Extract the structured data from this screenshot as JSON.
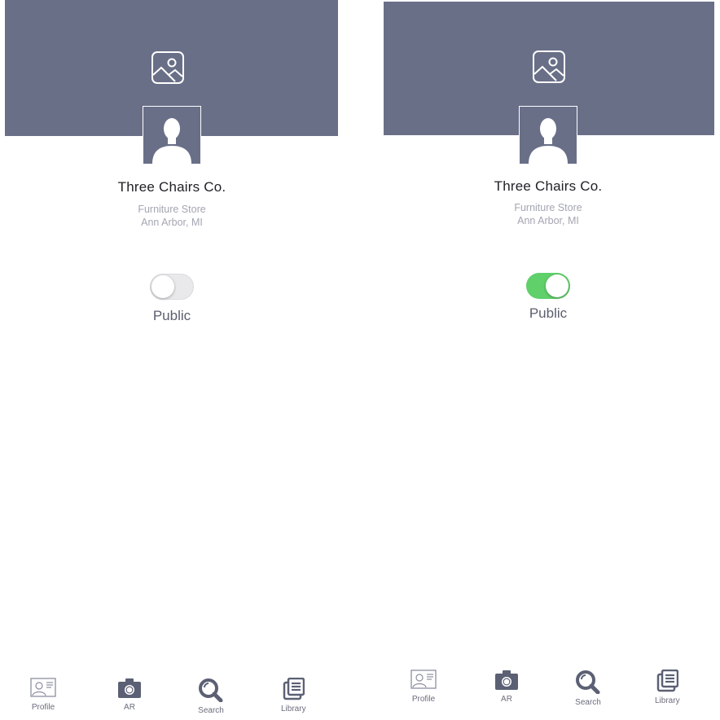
{
  "colors": {
    "cover": "#6a6f88",
    "toggle_on": "#5fd06a",
    "toggle_off": "#e9e9ec",
    "text_primary": "#1f1f26",
    "text_secondary": "#a4a6b2"
  },
  "screens": [
    {
      "state": "public-off",
      "cover": {
        "icon": "image-placeholder-icon"
      },
      "avatar": {
        "icon": "person-silhouette-icon"
      },
      "business_name": "Three Chairs Co.",
      "category": "Furniture Store",
      "location": "Ann Arbor, MI",
      "toggle": {
        "label": "Public",
        "on": false
      },
      "tabs": [
        {
          "label": "Profile",
          "icon": "profile-card-icon"
        },
        {
          "label": "AR",
          "icon": "camera-icon"
        },
        {
          "label": "Search",
          "icon": "search-icon"
        },
        {
          "label": "Library",
          "icon": "library-icon"
        }
      ]
    },
    {
      "state": "public-on",
      "cover": {
        "icon": "image-placeholder-icon"
      },
      "avatar": {
        "icon": "person-silhouette-icon"
      },
      "business_name": "Three Chairs Co.",
      "category": "Furniture Store",
      "location": "Ann Arbor, MI",
      "toggle": {
        "label": "Public",
        "on": true
      },
      "tabs": [
        {
          "label": "Profile",
          "icon": "profile-card-icon"
        },
        {
          "label": "AR",
          "icon": "camera-icon"
        },
        {
          "label": "Search",
          "icon": "search-icon"
        },
        {
          "label": "Library",
          "icon": "library-icon"
        }
      ]
    }
  ]
}
